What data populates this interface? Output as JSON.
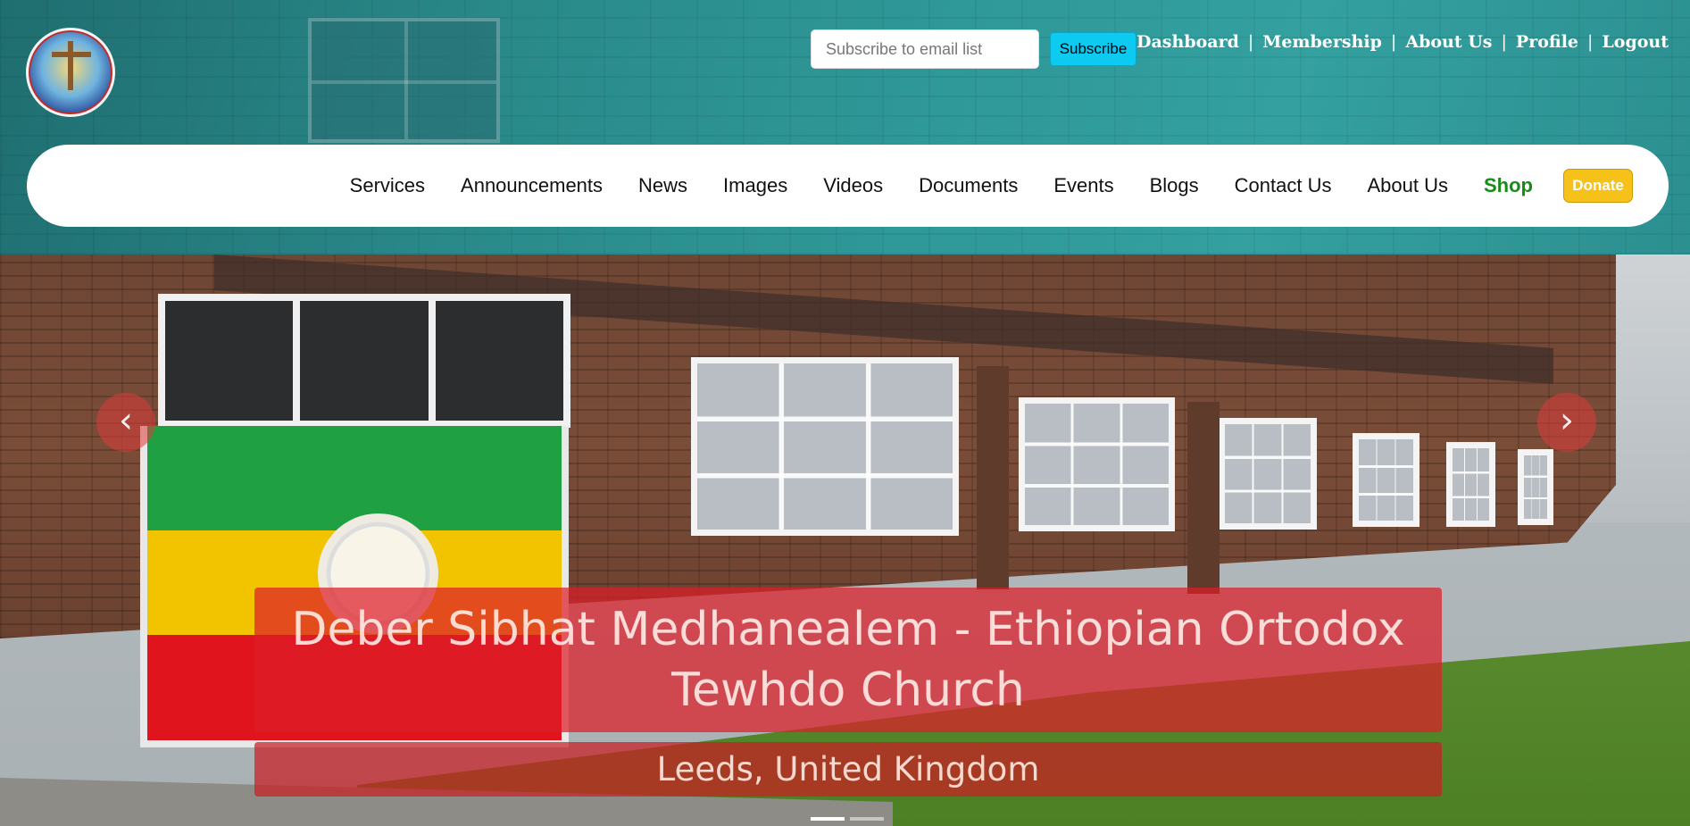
{
  "header": {
    "logo_icon": "church-logo-icon",
    "subscribe": {
      "placeholder": "Subscribe to email list",
      "value": "",
      "button_label": "Subscribe"
    },
    "top_links": [
      "Dashboard",
      "Membership",
      "About Us",
      "Profile",
      "Logout"
    ],
    "separator": "|"
  },
  "nav": {
    "items": [
      "Services",
      "Announcements",
      "News",
      "Images",
      "Videos",
      "Documents",
      "Events",
      "Blogs",
      "Contact Us",
      "About Us"
    ],
    "shop_label": "Shop",
    "donate_label": "Donate"
  },
  "hero": {
    "title": "Deber Sibhat Medhanealem - Ethiopian Ortodox Tewhdo Church",
    "subtitle": "Leeds, United Kingdom",
    "prev_icon": "chevron-left-icon",
    "next_icon": "chevron-right-icon",
    "prev_glyph": "‹",
    "next_glyph": "›",
    "slide_count": 2,
    "active_slide": 1
  },
  "colors": {
    "header_bg": "#2a8a8a",
    "subscribe_button": "#0dcaf0",
    "shop_text": "#1a8a1a",
    "donate_button": "#f6c21a",
    "caption_bg": "#dc1e28"
  }
}
